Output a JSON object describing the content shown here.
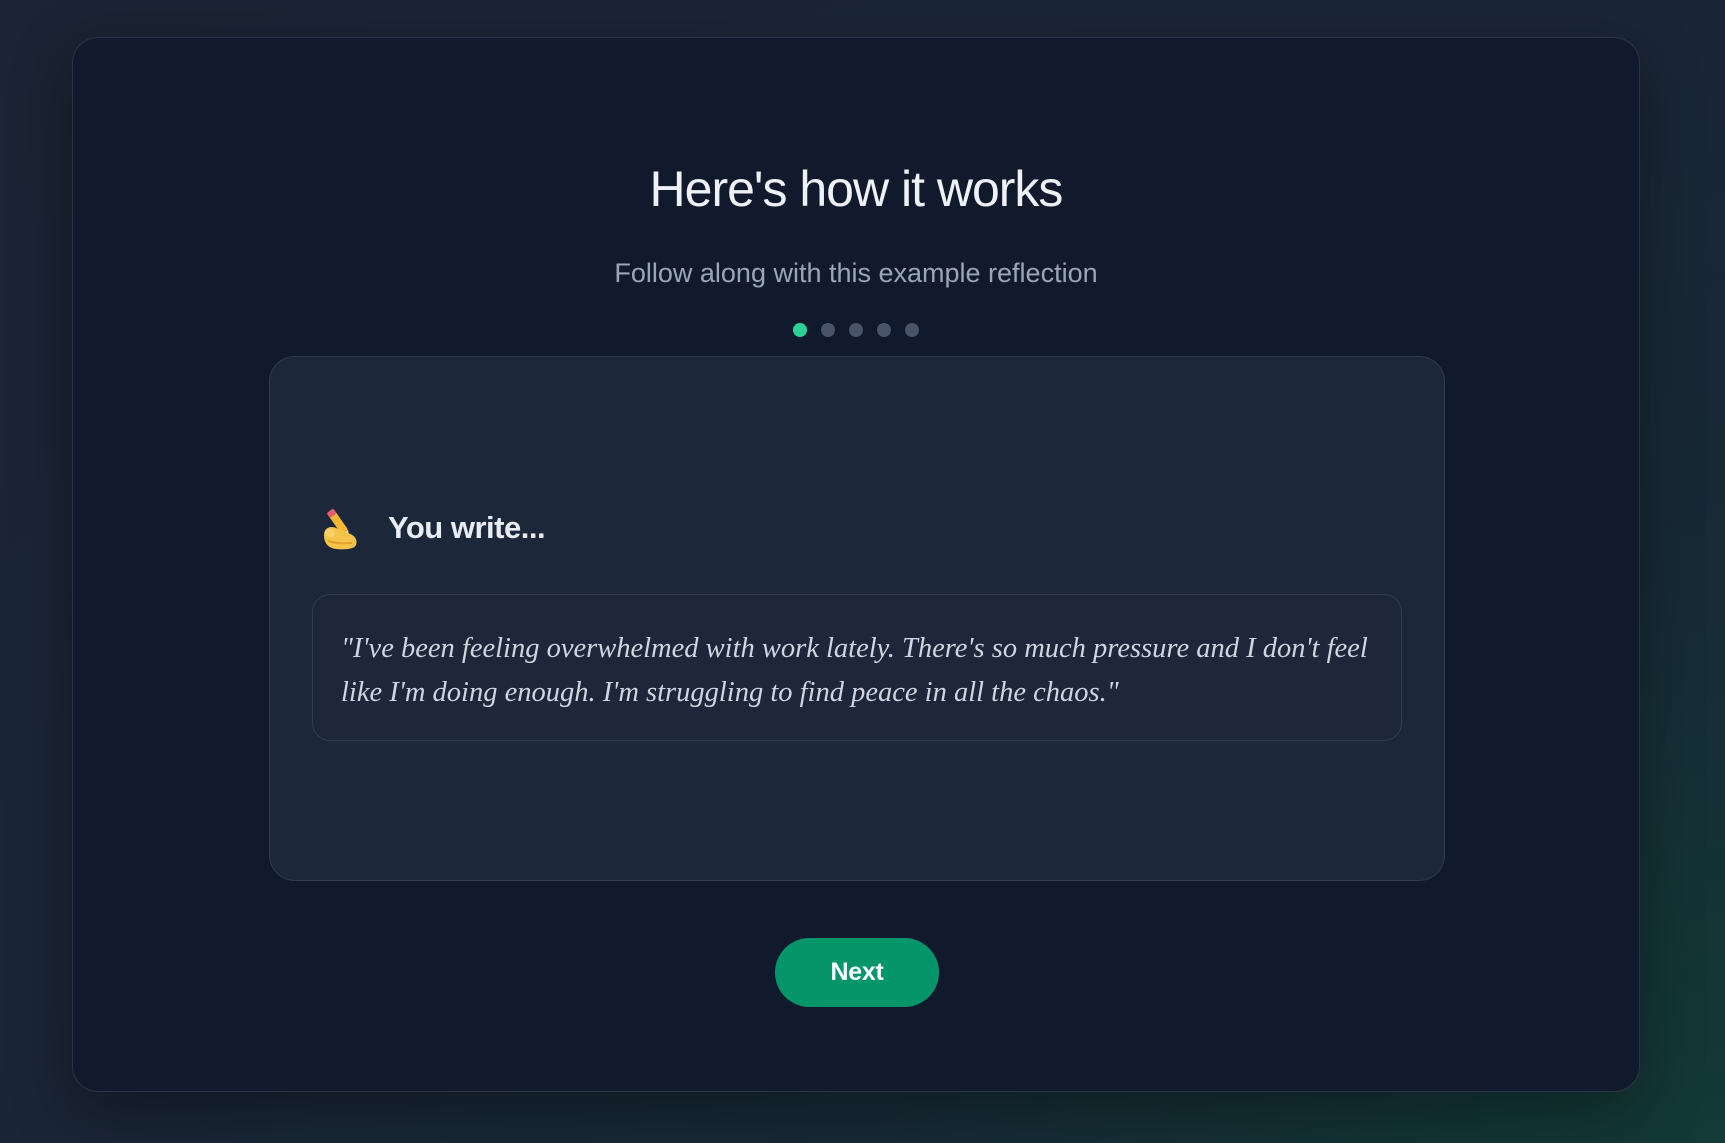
{
  "header": {
    "title": "Here's how it works",
    "subtitle": "Follow along with this example reflection"
  },
  "steps": {
    "total": 5,
    "active": 1
  },
  "example": {
    "icon": "writing-hand-icon",
    "heading": "You write...",
    "quote": "\"I've been feeling overwhelmed with work lately. There's so much pressure and I don't feel like I'm doing enough. I'm struggling to find peace in all the chaos.\""
  },
  "actions": {
    "next_label": "Next"
  },
  "colors": {
    "accent": "#2bd194",
    "button": "#049669",
    "card_bg": "#111a2d",
    "inner_card_bg": "#1d273a"
  }
}
